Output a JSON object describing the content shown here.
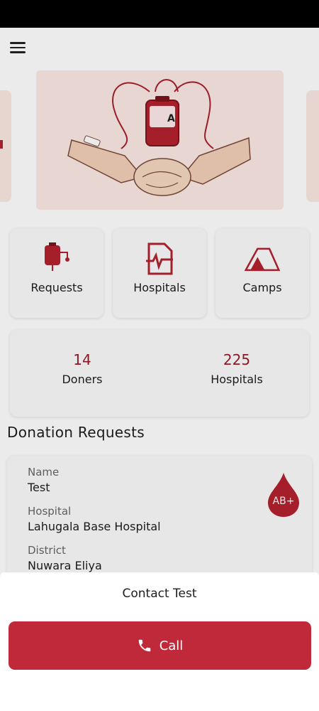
{
  "colors": {
    "accent": "#c0293a",
    "blood_red": "#9a1b26",
    "card_bg": "#fbfbfb",
    "banner_bg": "#fbe9e4"
  },
  "header": {
    "menu_icon": "hamburger-menu-icon"
  },
  "banner": {
    "bag_label": "A"
  },
  "features": [
    {
      "label": "Requests",
      "icon": "blood-bag-icon"
    },
    {
      "label": "Hospitals",
      "icon": "medical-document-icon"
    },
    {
      "label": "Camps",
      "icon": "tent-icon"
    }
  ],
  "stats": [
    {
      "value": "14",
      "label": "Doners"
    },
    {
      "value": "225",
      "label": "Hospitals"
    }
  ],
  "section": {
    "title": "Donation Requests"
  },
  "request": {
    "name_key": "Name",
    "name": "Test",
    "hospital_key": "Hospital",
    "hospital": "Lahugala Base Hospital",
    "district_key": "District",
    "district": "Nuwara Eliya",
    "blood_type": "AB+"
  },
  "sheet": {
    "title": "Contact Test",
    "call_label": "Call",
    "call_icon": "phone-icon"
  }
}
